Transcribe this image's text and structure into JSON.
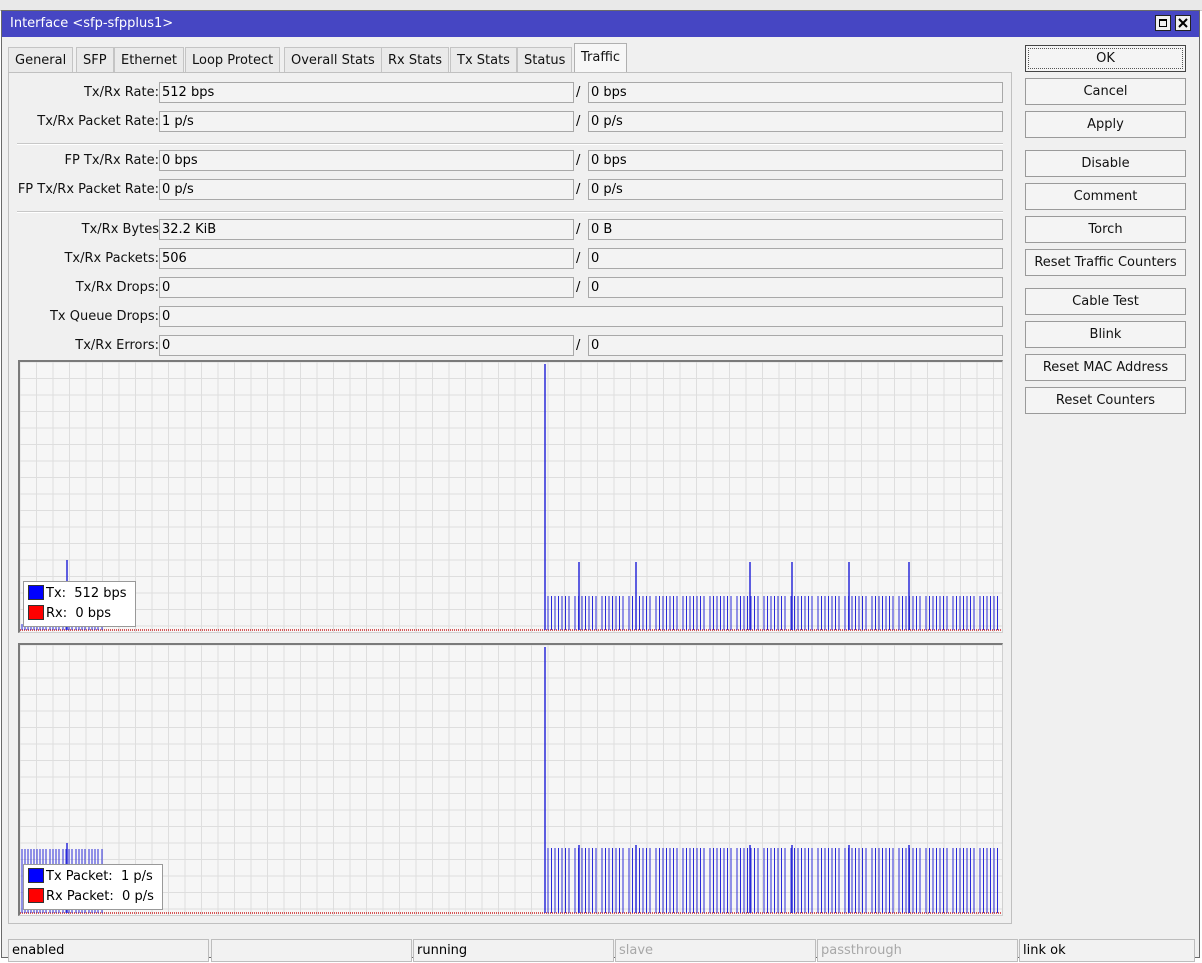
{
  "window": {
    "title": "Interface <sfp-sfpplus1>"
  },
  "tabs": [
    "General",
    "SFP",
    "Ethernet",
    "Loop Protect",
    "Overall Stats",
    "Rx Stats",
    "Tx Stats",
    "Status",
    "Traffic"
  ],
  "active_tab": "Traffic",
  "fields": {
    "txrx_rate": {
      "label": "Tx/Rx Rate:",
      "tx": "512 bps",
      "rx": "0 bps"
    },
    "txrx_packet_rate": {
      "label": "Tx/Rx Packet Rate:",
      "tx": "1 p/s",
      "rx": "0 p/s"
    },
    "fp_txrx_rate": {
      "label": "FP Tx/Rx Rate:",
      "tx": "0 bps",
      "rx": "0 bps"
    },
    "fp_txrx_packet_rate": {
      "label": "FP Tx/Rx Packet Rate:",
      "tx": "0 p/s",
      "rx": "0 p/s"
    },
    "txrx_bytes": {
      "label": "Tx/Rx Bytes",
      "tx": "32.2 KiB",
      "rx": "0 B"
    },
    "txrx_packets": {
      "label": "Tx/Rx Packets:",
      "tx": "506",
      "rx": "0"
    },
    "txrx_drops": {
      "label": "Tx/Rx Drops:",
      "tx": "0",
      "rx": "0"
    },
    "tx_queue_drops": {
      "label": "Tx Queue Drops:",
      "value": "0"
    },
    "txrx_errors": {
      "label": "Tx/Rx Errors:",
      "tx": "0",
      "rx": "0"
    },
    "separator": "/"
  },
  "graphs": {
    "traffic": {
      "legend": [
        {
          "label": "Tx:",
          "value": "512 bps",
          "color": "#0000ff"
        },
        {
          "label": "Rx:",
          "value": "0 bps",
          "color": "#ff0000"
        }
      ]
    },
    "packets": {
      "legend": [
        {
          "label": "Tx Packet:",
          "value": "1 p/s",
          "color": "#0000ff"
        },
        {
          "label": "Rx Packet:",
          "value": "0 p/s",
          "color": "#ff0000"
        }
      ]
    },
    "colors": {
      "tx": "#2a2ad8",
      "rx": "#cc2222",
      "grid": "#dedede"
    }
  },
  "buttons": [
    "OK",
    "Cancel",
    "Apply",
    "Disable",
    "Comment",
    "Torch",
    "Reset Traffic Counters",
    "Cable Test",
    "Blink",
    "Reset MAC Address",
    "Reset Counters"
  ],
  "status": [
    "enabled",
    "",
    "running",
    "slave",
    "passthrough",
    "link ok"
  ]
}
